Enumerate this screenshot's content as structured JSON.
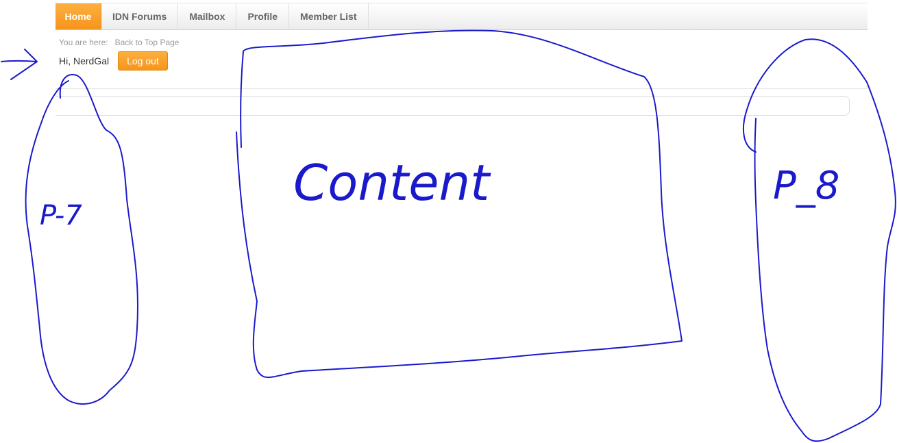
{
  "nav": {
    "items": [
      {
        "label": "Home"
      },
      {
        "label": "IDN Forums"
      },
      {
        "label": "Mailbox"
      },
      {
        "label": "Profile"
      },
      {
        "label": "Member List"
      }
    ]
  },
  "breadcrumb": {
    "prefix": "You are here:",
    "link": "Back to Top Page"
  },
  "user": {
    "greeting": "Hi, NerdGal",
    "logout_label": "Log out"
  },
  "annotations": {
    "left_label": "P-7",
    "center_label": "Content",
    "right_label": "P_8"
  },
  "colors": {
    "accent": "#f7941d",
    "annotation_ink": "#1a1acc"
  }
}
